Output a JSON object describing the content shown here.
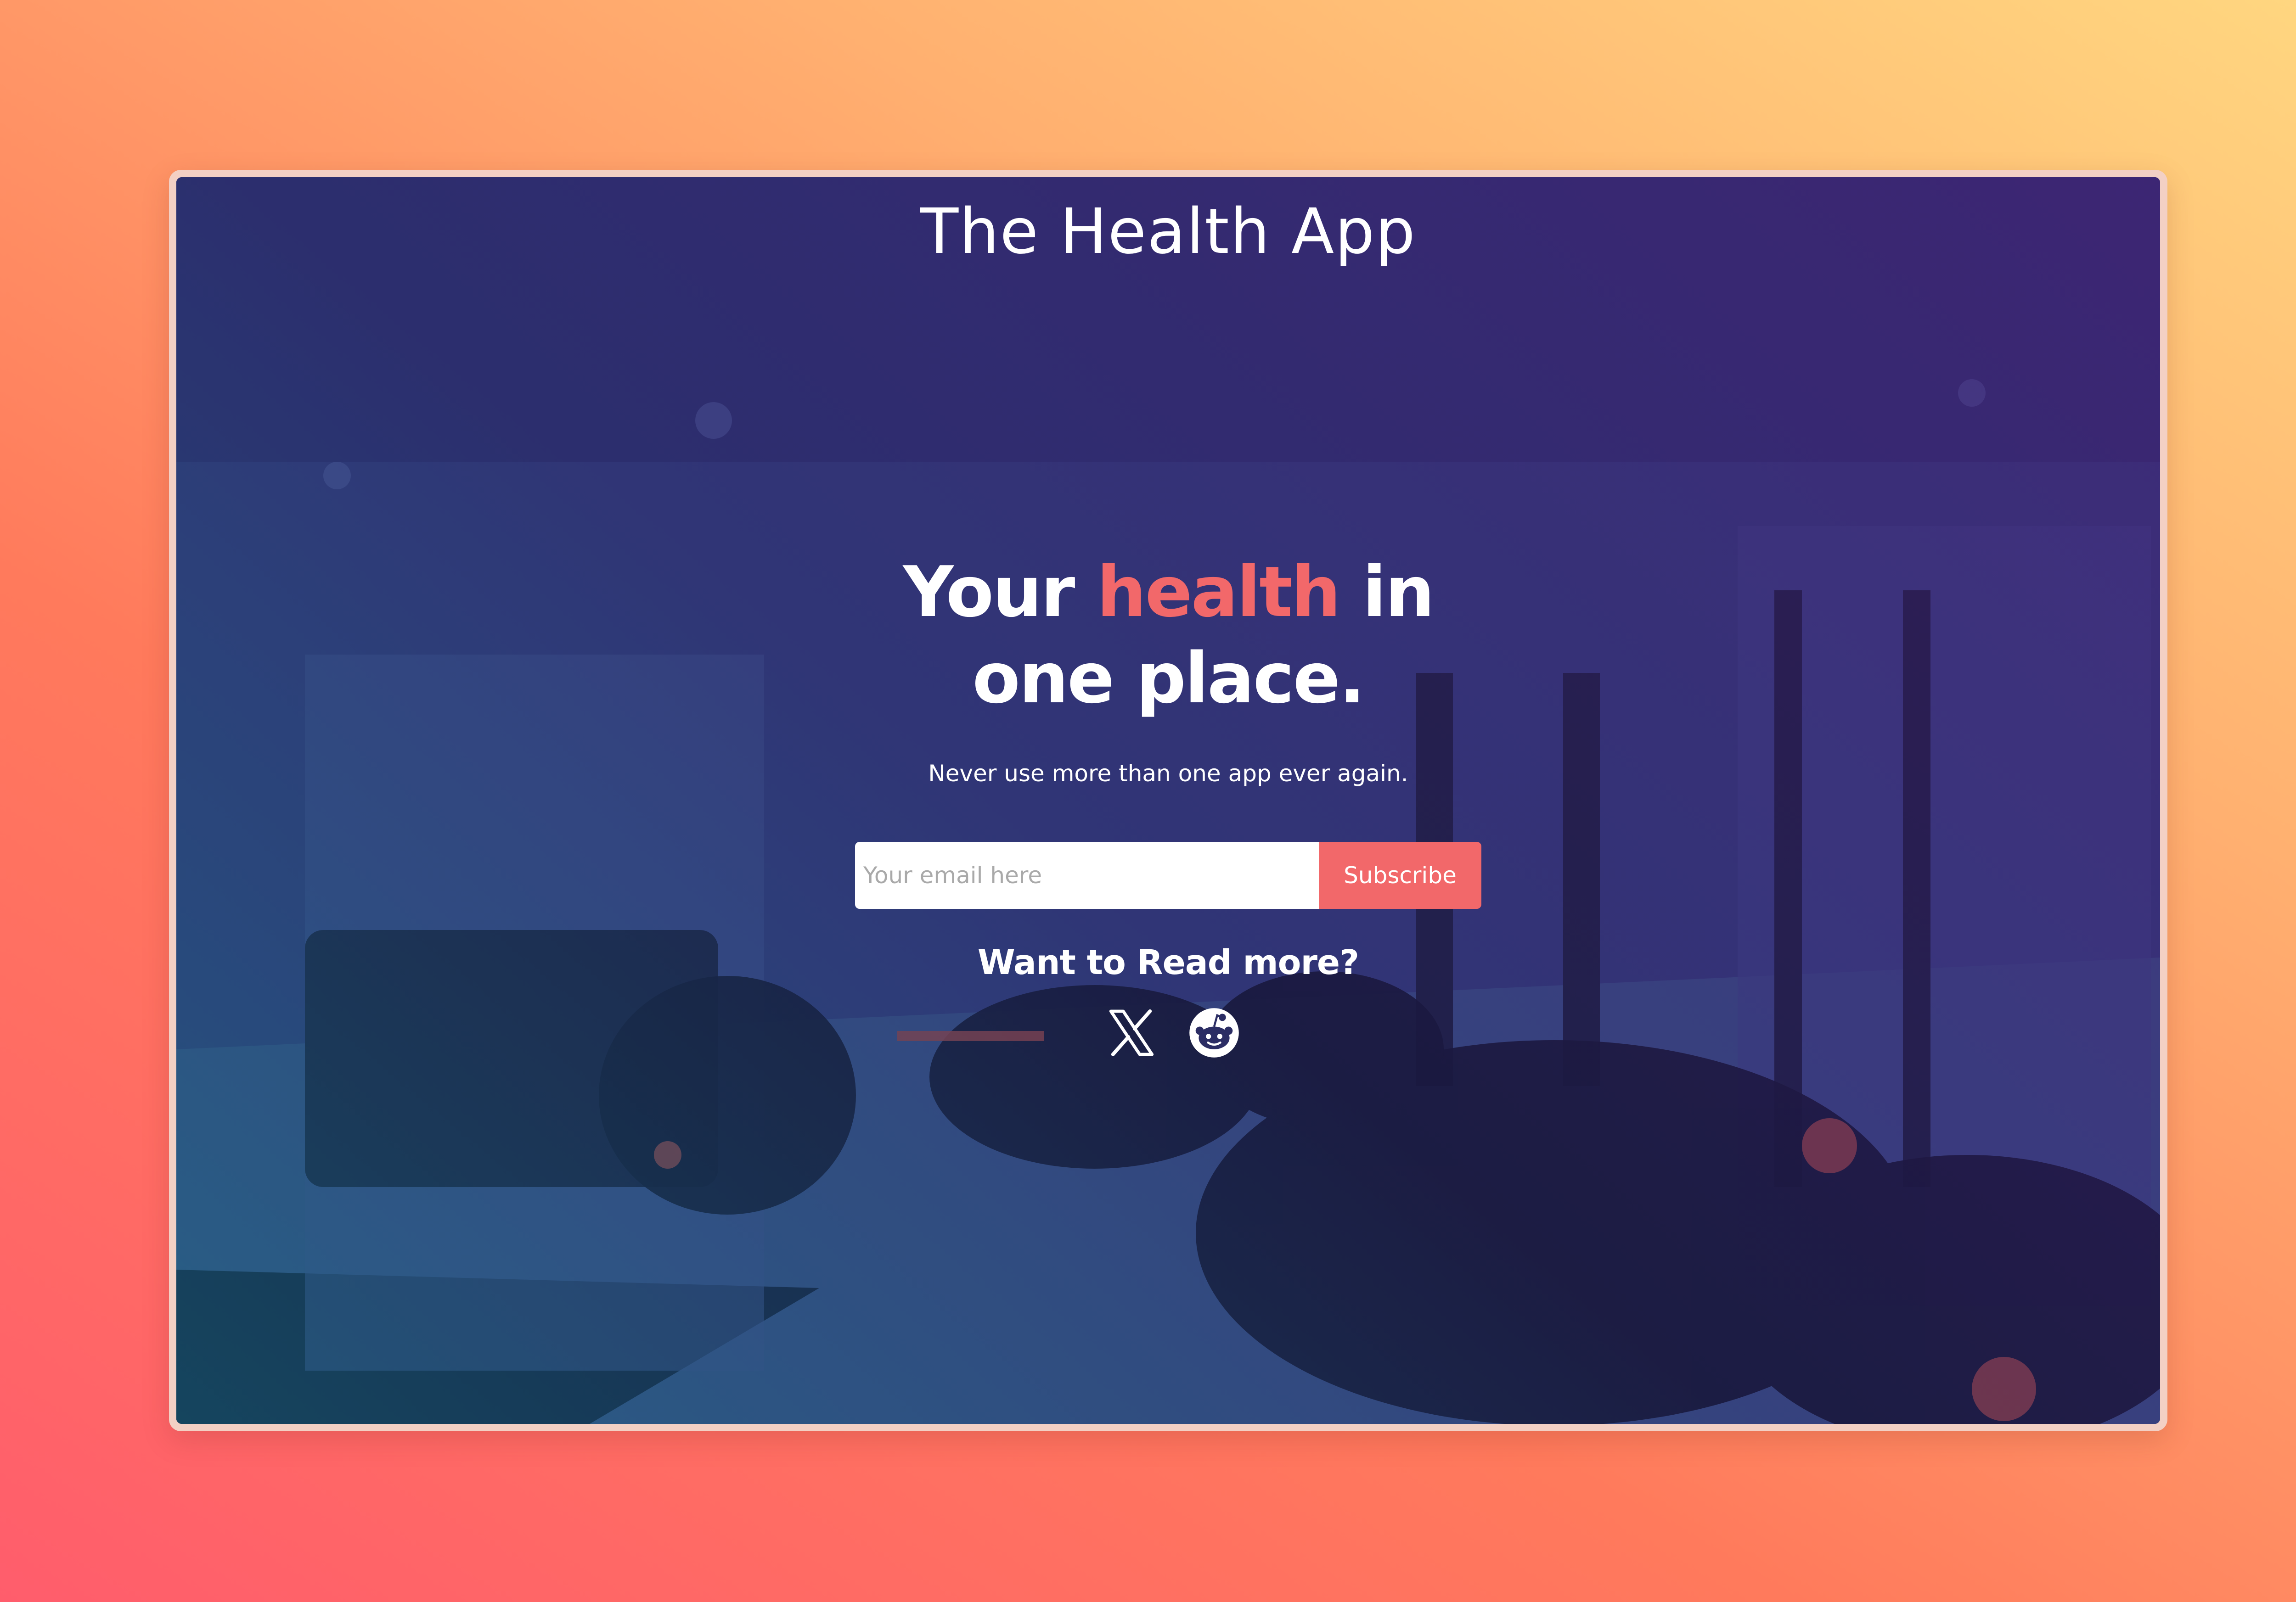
{
  "brand": {
    "title": "The Health App"
  },
  "hero": {
    "headline_before": "Your ",
    "headline_accent": "health",
    "headline_after": " in one place.",
    "tagline": "Never use more than one app ever again.",
    "accent_color": "#f2686a"
  },
  "signup": {
    "email_placeholder": "Your email here",
    "email_value": "",
    "subscribe_label": "Subscribe"
  },
  "read_more": {
    "heading": "Want to Read more?",
    "links": [
      {
        "icon": "x-logo-icon"
      },
      {
        "icon": "reddit-icon"
      }
    ]
  }
}
